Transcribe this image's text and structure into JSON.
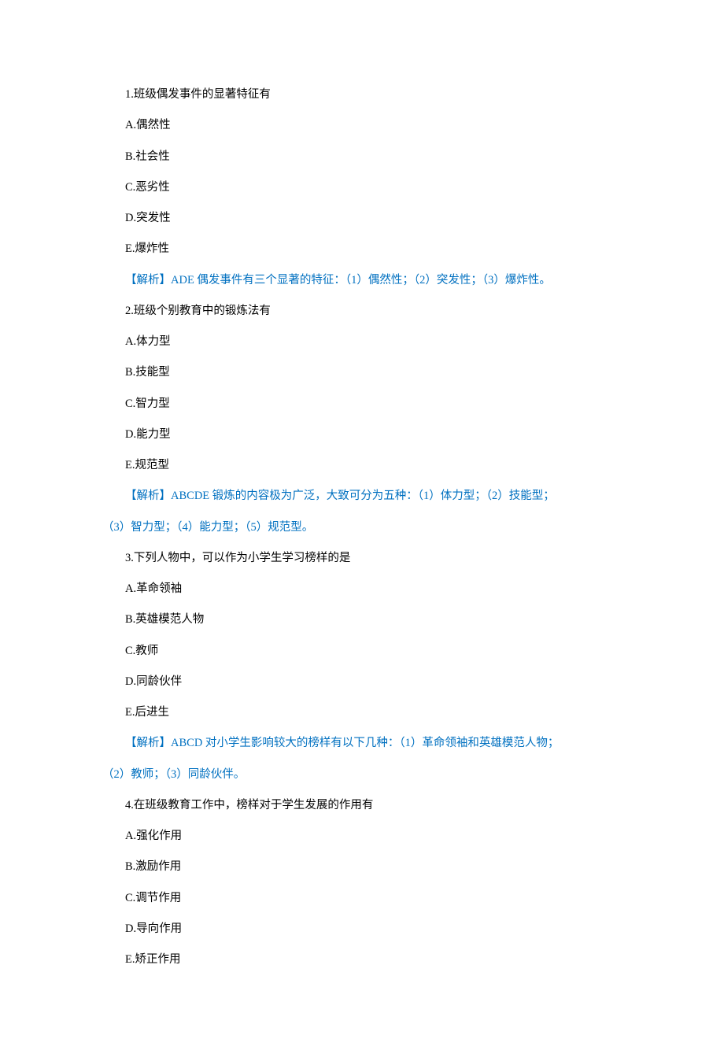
{
  "q1": {
    "stem": "1.班级偶发事件的显著特征有",
    "A": "A.偶然性",
    "B": "B.社会性",
    "C": "C.恶劣性",
    "D": "D.突发性",
    "E": "E.爆炸性",
    "analysis": "【解析】ADE 偶发事件有三个显著的特征：（1）偶然性；（2）突发性；（3）爆炸性。"
  },
  "q2": {
    "stem": "2.班级个别教育中的锻炼法有",
    "A": "A.体力型",
    "B": "B.技能型",
    "C": "C.智力型",
    "D": "D.能力型",
    "E": "E.规范型",
    "analysis_l1": "【解析】ABCDE 锻炼的内容极为广泛，大致可分为五种：（1）体力型；（2）技能型；",
    "analysis_l2": "（3）智力型；（4）能力型；（5）规范型。"
  },
  "q3": {
    "stem": "3.下列人物中，可以作为小学生学习榜样的是",
    "A": "A.革命领袖",
    "B": "B.英雄模范人物",
    "C": "C.教师",
    "D": "D.同龄伙伴",
    "E": "E.后进生",
    "analysis_l1": "【解析】ABCD 对小学生影响较大的榜样有以下几种：（1）革命领袖和英雄模范人物；",
    "analysis_l2": "（2）教师；（3）同龄伙伴。"
  },
  "q4": {
    "stem": "4.在班级教育工作中，榜样对于学生发展的作用有",
    "A": "A.强化作用",
    "B": "B.激励作用",
    "C": "C.调节作用",
    "D": "D.导向作用",
    "E": "E.矫正作用"
  }
}
